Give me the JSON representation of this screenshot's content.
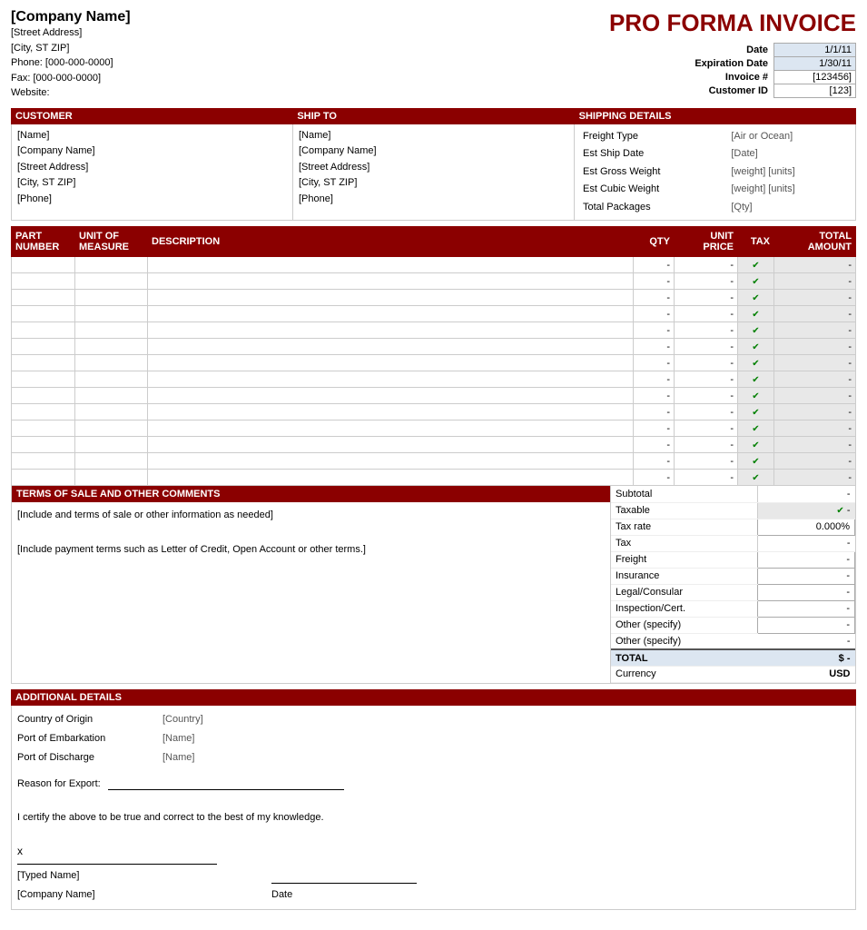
{
  "header": {
    "company_name": "[Company Name]",
    "street": "[Street Address]",
    "city": "[City, ST  ZIP]",
    "phone": "Phone: [000-000-0000]",
    "fax": "Fax: [000-000-0000]",
    "website": "Website:",
    "invoice_title": "PRO FORMA INVOICE",
    "meta": {
      "date_label": "Date",
      "date_value": "1/1/11",
      "expiration_label": "Expiration Date",
      "expiration_value": "1/30/11",
      "invoice_label": "Invoice #",
      "invoice_value": "[123456]",
      "customer_label": "Customer ID",
      "customer_value": "[123]"
    }
  },
  "customer": {
    "header": "CUSTOMER",
    "name": "[Name]",
    "company": "[Company Name]",
    "street": "[Street Address]",
    "city": "[City, ST  ZIP]",
    "phone": "[Phone]"
  },
  "ship_to": {
    "header": "SHIP TO",
    "name": "[Name]",
    "company": "[Company Name]",
    "street": "[Street Address]",
    "city": "[City, ST  ZIP]",
    "phone": "[Phone]"
  },
  "shipping_details": {
    "header": "SHIPPING DETAILS",
    "freight_type_label": "Freight Type",
    "freight_type_value": "[Air or Ocean]",
    "ship_date_label": "Est Ship Date",
    "ship_date_value": "[Date]",
    "gross_weight_label": "Est Gross Weight",
    "gross_weight_value": "[weight] [units]",
    "cubic_weight_label": "Est Cubic Weight",
    "cubic_weight_value": "[weight] [units]",
    "packages_label": "Total Packages",
    "packages_value": "[Qty]"
  },
  "table": {
    "headers": {
      "part": "PART NUMBER",
      "uom": "UNIT OF MEASURE",
      "desc": "DESCRIPTION",
      "qty": "QTY",
      "price": "UNIT PRICE",
      "tax": "TAX",
      "total": "TOTAL AMOUNT"
    },
    "rows": 14,
    "dash": "-"
  },
  "terms": {
    "header": "TERMS OF SALE AND OTHER COMMENTS",
    "line1": "[Include and terms of sale or other information as needed]",
    "line2": "[Include payment terms such as Letter of Credit, Open Account or other terms.]"
  },
  "totals": {
    "subtotal_label": "Subtotal",
    "subtotal_value": "-",
    "taxable_label": "Taxable",
    "taxable_value": "-",
    "tax_rate_label": "Tax rate",
    "tax_rate_value": "0.000%",
    "tax_label": "Tax",
    "tax_value": "-",
    "freight_label": "Freight",
    "freight_value": "-",
    "insurance_label": "Insurance",
    "insurance_value": "-",
    "legal_label": "Legal/Consular",
    "legal_value": "-",
    "inspection_label": "Inspection/Cert.",
    "inspection_value": "-",
    "other1_label": "Other (specify)",
    "other1_value": "-",
    "other2_label": "Other (specify)",
    "other2_value": "-",
    "total_label": "TOTAL",
    "total_dollar": "$",
    "total_value": "-",
    "currency_label": "Currency",
    "currency_value": "USD"
  },
  "additional": {
    "header": "ADDITIONAL DETAILS",
    "origin_label": "Country of Origin",
    "origin_value": "[Country]",
    "embarkation_label": "Port of Embarkation",
    "embarkation_value": "[Name]",
    "discharge_label": "Port of Discharge",
    "discharge_value": "[Name]",
    "reason_label": "Reason for Export:",
    "certify_text": "I certify the above to be true and correct to the best of my knowledge.",
    "x_label": "x",
    "typed_name": "[Typed Name]",
    "company_sig": "[Company Name]",
    "date_label": "Date"
  }
}
